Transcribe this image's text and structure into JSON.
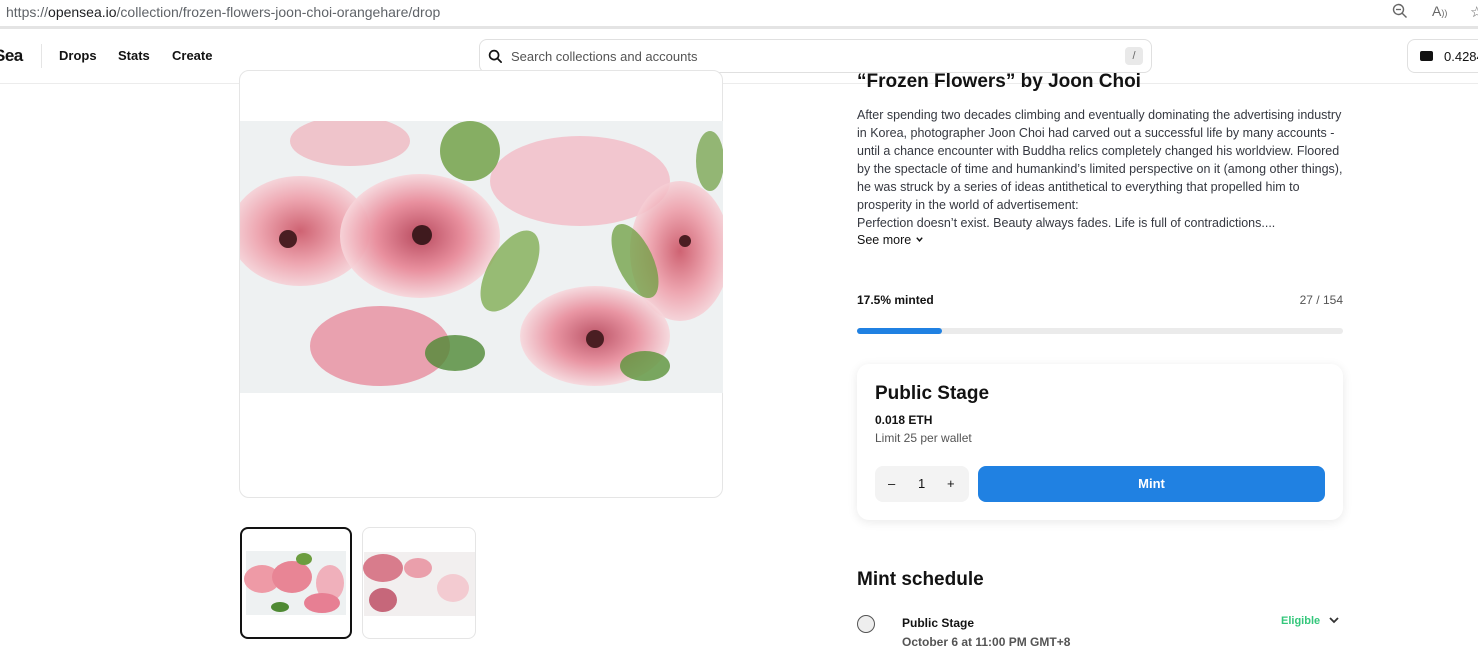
{
  "browser": {
    "url_prefix": "https://",
    "url_domain": "opensea.io",
    "url_path": "/collection/frozen-flowers-joon-choi-orangehare/drop",
    "icons": [
      "zoom-out-icon",
      "read-aloud-icon",
      "favorite-icon"
    ]
  },
  "header": {
    "logo": "Sea",
    "nav": [
      "Drops",
      "Stats",
      "Create"
    ],
    "search_placeholder": "Search collections and accounts",
    "search_shortcut": "/",
    "wallet_balance": "0.4284"
  },
  "collection": {
    "title": "“Frozen Flowers” by Joon Choi",
    "description": [
      "After spending two decades climbing and eventually dominating the advertising industry in Korea, photographer Joon Choi had carved out a successful life by many accounts - until a chance encounter with Buddha relics completely changed his worldview. Floored by the spectacle of time and humankind’s limited perspective on it (among other things), he was struck by a series of ideas antithetical to everything that propelled him to prosperity in the world of advertisement:",
      "Perfection doesn’t exist. Beauty always fades. Life is full of contradictions...."
    ],
    "see_more": "See more"
  },
  "minting": {
    "percent_label": "17.5% minted",
    "count": "27 / 154",
    "progress_fraction": 0.175
  },
  "stage": {
    "name": "Public Stage",
    "price": "0.018 ETH",
    "limit": "Limit 25 per wallet",
    "quantity": "1",
    "minus": "–",
    "plus": "+",
    "mint_label": "Mint"
  },
  "schedule": {
    "title": "Mint schedule",
    "items": [
      {
        "name": "Public Stage",
        "date": "October 6 at 11:00 PM GMT+8",
        "status": "Eligible"
      }
    ]
  },
  "colors": {
    "accent": "#2081e2",
    "eligible": "#34c77b"
  }
}
